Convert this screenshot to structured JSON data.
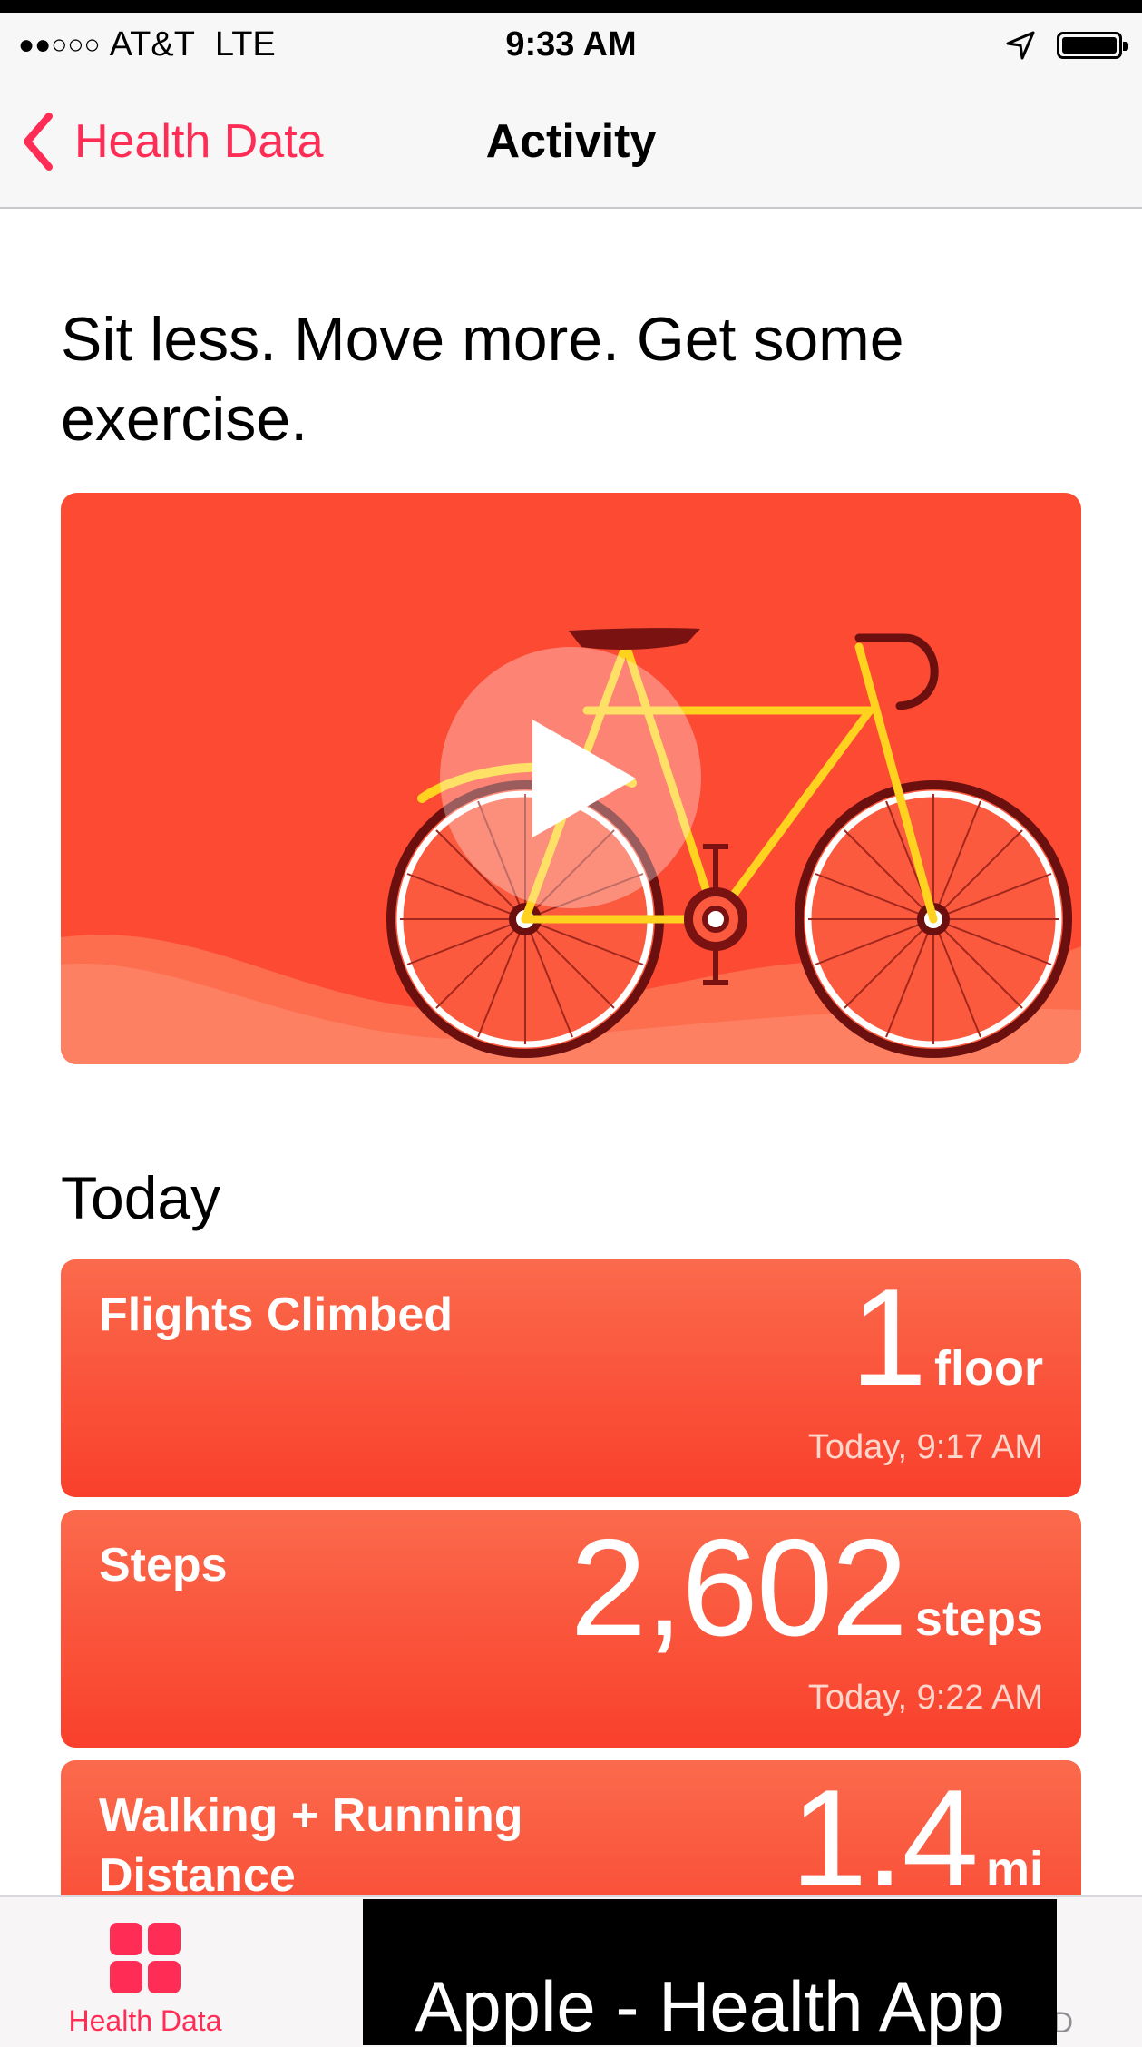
{
  "status_bar": {
    "signal": "●●○○○",
    "carrier": "AT&T",
    "network": "LTE",
    "time": "9:33 AM"
  },
  "nav": {
    "back_label": "Health Data",
    "title": "Activity"
  },
  "headline": "Sit less. Move more. Get some exercise.",
  "section_title": "Today",
  "cards": [
    {
      "label": "Flights Climbed",
      "value": "1",
      "unit": "floor",
      "time": "Today, 9:17 AM"
    },
    {
      "label": "Steps",
      "value": "2,602",
      "unit": "steps",
      "time": "Today, 9:22 AM"
    },
    {
      "label": "Walking + Running Distance",
      "value": "1.4",
      "unit": "mi",
      "time": ""
    }
  ],
  "tab_bar": {
    "health_data_label": "Health Data",
    "partial_tab_label": "D"
  },
  "overlay_caption": "Apple - Health App",
  "colors": {
    "accent": "#ff2d55",
    "card_red": "#f9402c",
    "video_bg": "#fc4a33",
    "bike_yellow": "#ffd21f"
  },
  "icons": [
    "back-chevron-icon",
    "location-arrow-icon",
    "battery-icon",
    "play-icon",
    "health-data-grid-icon"
  ]
}
